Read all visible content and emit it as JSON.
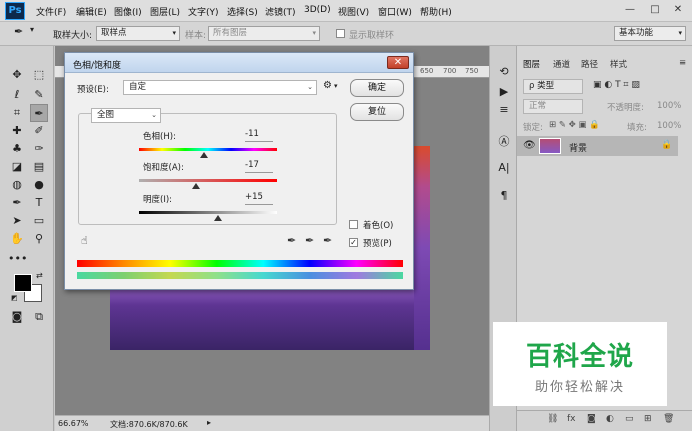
{
  "app": {
    "logo": "Ps"
  },
  "menubar": {
    "items": [
      "文件(F)",
      "编辑(E)",
      "图像(I)",
      "图层(L)",
      "文字(Y)",
      "选择(S)",
      "滤镜(T)",
      "3D(D)",
      "视图(V)",
      "窗口(W)",
      "帮助(H)"
    ],
    "window_controls": [
      "—",
      "□",
      "✕"
    ]
  },
  "options_bar": {
    "sample_size_label": "取样大小:",
    "sample_size_value": "取样点",
    "sample_label": "样本:",
    "sample_value": "所有图层",
    "show_ring_label": "显示取样环",
    "workspace": "基本功能"
  },
  "ruler": {
    "ticks": [
      "650",
      "700",
      "750"
    ]
  },
  "statusbar": {
    "zoom": "66.67%",
    "doc_info": "文档:870.6K/870.6K"
  },
  "dialog": {
    "title": "色相/饱和度",
    "close": "✕",
    "preset_label": "预设(E):",
    "preset_value": "自定",
    "channel_value": "全图",
    "ok_label": "确定",
    "reset_label": "复位",
    "hue_label": "色相(H):",
    "hue_value": "-11",
    "hue_level": 0.47,
    "saturation_label": "饱和度(A):",
    "saturation_value": "-17",
    "saturation_level": 0.41,
    "lightness_label": "明度(I):",
    "lightness_value": "+15",
    "lightness_level": 0.57,
    "colorize_label": "着色(O)",
    "colorize_checked": false,
    "preview_label": "预览(P)",
    "preview_checked": true
  },
  "panels": {
    "tabs": [
      "图层",
      "通道",
      "路径",
      "样式"
    ],
    "kind_filter": "ρ 类型",
    "blend_mode": "正常",
    "opacity_label": "不透明度:",
    "opacity_value": "100%",
    "lock_label": "锁定:",
    "fill_label": "填充:",
    "fill_value": "100%",
    "layer_name": "背景"
  },
  "watermark": {
    "title": "百科全说",
    "subtitle": "助你轻松解决"
  },
  "colors": {
    "accent": "#31a8ff",
    "watermark_green": "#1fa64a",
    "dialog_title": "#c0d5ed"
  }
}
